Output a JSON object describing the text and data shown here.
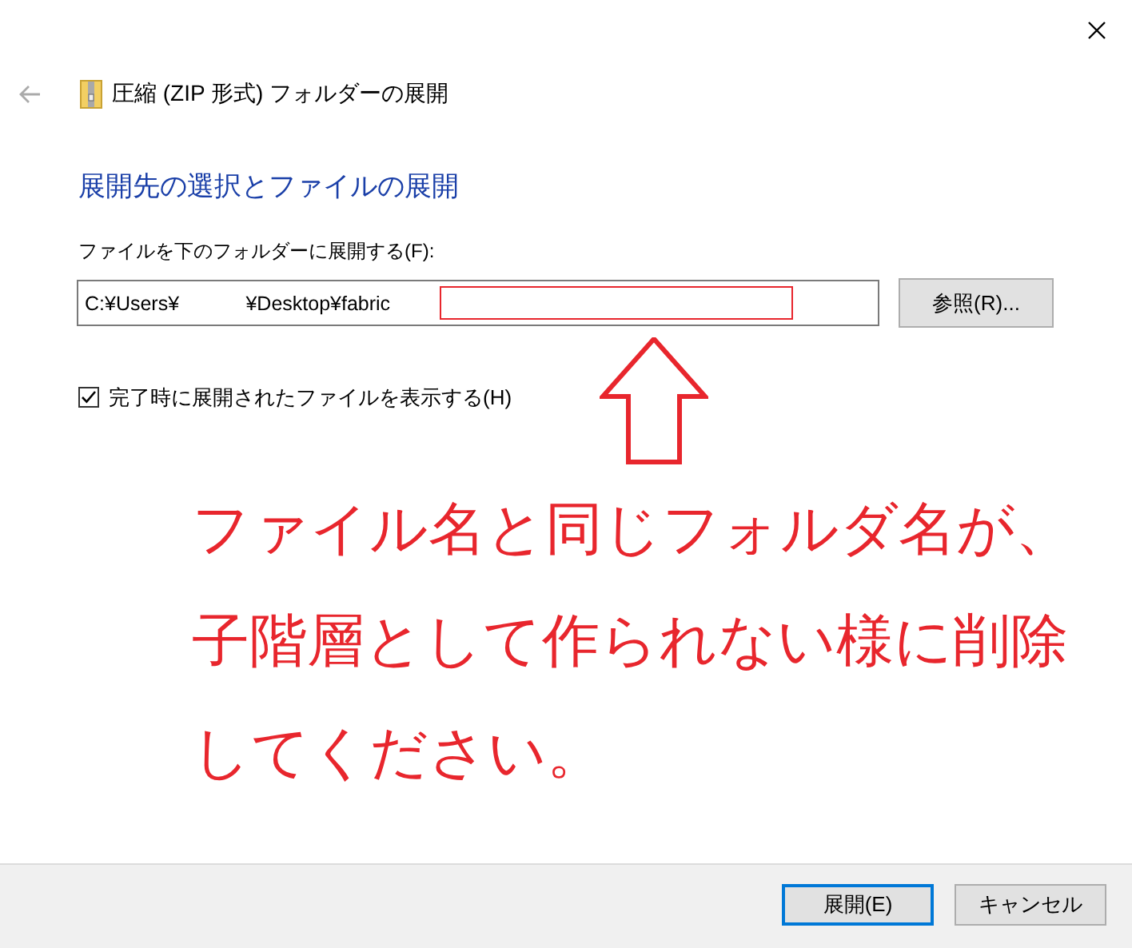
{
  "window": {
    "title": "圧縮 (ZIP 形式) フォルダーの展開"
  },
  "heading": "展開先の選択とファイルの展開",
  "destination": {
    "label": "ファイルを下のフォルダーに展開する(F):",
    "value": "C:¥Users¥            ¥Desktop¥fabric",
    "browse_button": "参照(R)..."
  },
  "show_files": {
    "label": "完了時に展開されたファイルを表示する(H)",
    "checked": true
  },
  "annotation": {
    "lines": [
      "ファイル名と同じフォルダ名が、",
      "子階層として作られない様に削除",
      "してください。"
    ]
  },
  "buttons": [
    {
      "label": "展開(E)",
      "default": true
    },
    {
      "label": "キャンセル",
      "default": false
    }
  ]
}
